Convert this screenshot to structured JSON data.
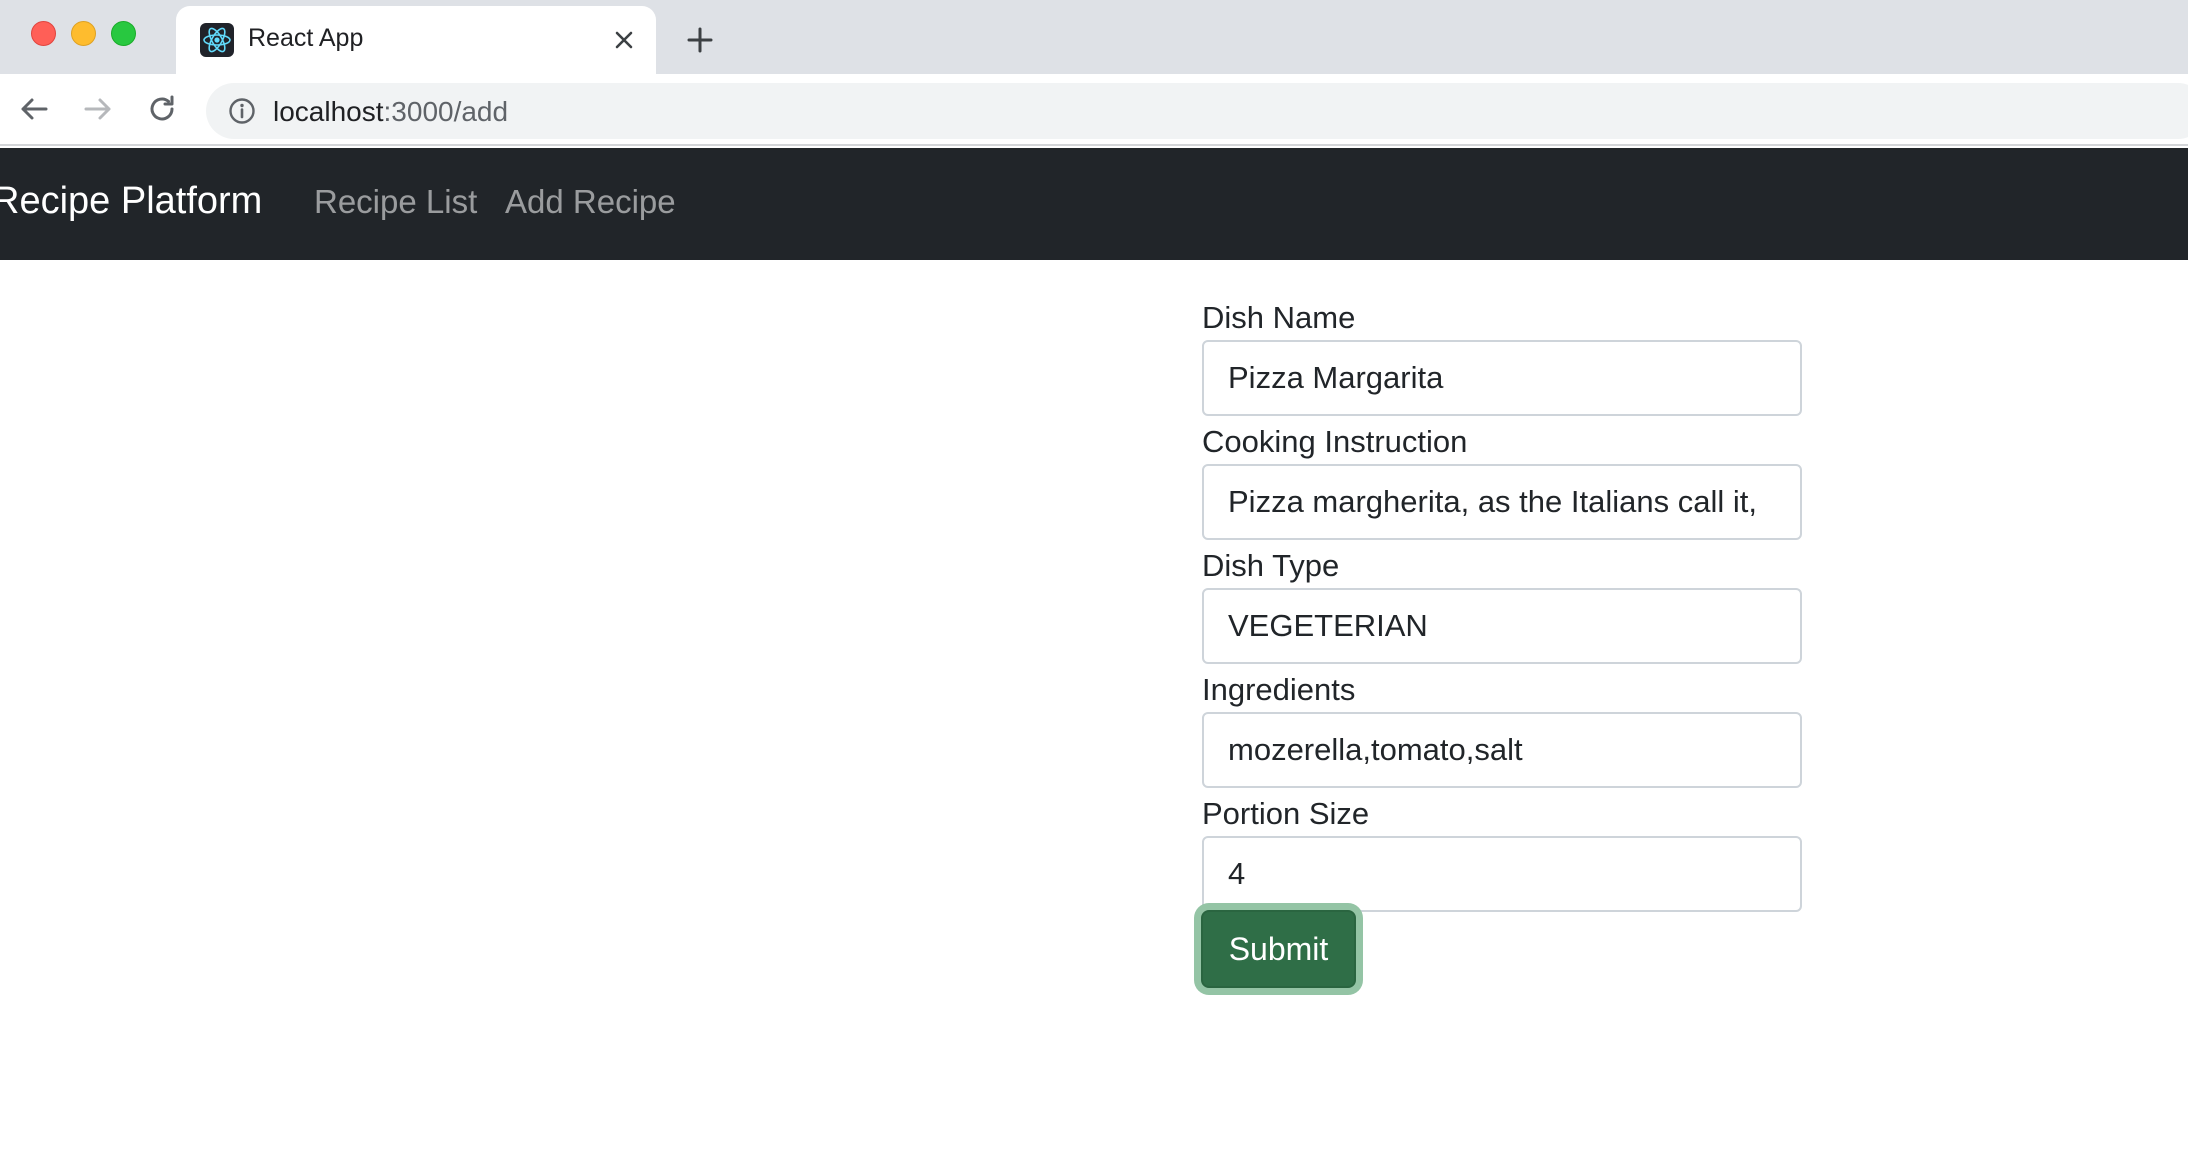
{
  "browser": {
    "tab_title": "React App",
    "url_host": "localhost",
    "url_path": ":3000/add"
  },
  "navbar": {
    "brand": "Recipe Platform",
    "links": [
      "Recipe List",
      "Add Recipe"
    ]
  },
  "form": {
    "fields": [
      {
        "label": "Dish Name",
        "value": "Pizza Margarita"
      },
      {
        "label": "Cooking Instruction",
        "value": "Pizza margherita, as the Italians call it,"
      },
      {
        "label": "Dish Type",
        "value": "VEGETERIAN"
      },
      {
        "label": "Ingredients",
        "value": "mozerella,tomato,salt"
      },
      {
        "label": "Portion Size",
        "value": "4"
      }
    ],
    "submit_label": "Submit"
  },
  "colors": {
    "navbar_bg": "#212529",
    "submit_bg": "#2f6e47",
    "submit_focus_ring": "#94c4a5"
  }
}
